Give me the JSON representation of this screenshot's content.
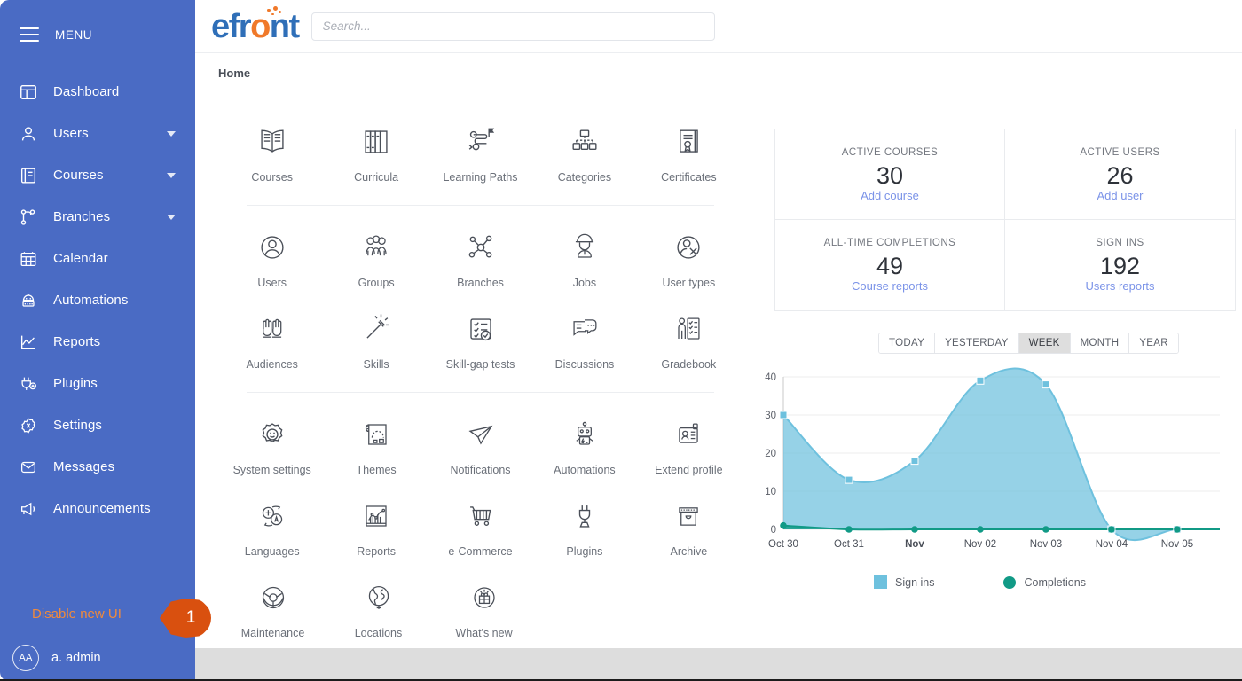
{
  "sidebar": {
    "menu_label": "MENU",
    "items": [
      {
        "label": "Dashboard",
        "icon": "dashboard-icon",
        "expandable": false
      },
      {
        "label": "Users",
        "icon": "user-icon",
        "expandable": true
      },
      {
        "label": "Courses",
        "icon": "book-icon",
        "expandable": true
      },
      {
        "label": "Branches",
        "icon": "branches-icon",
        "expandable": true
      },
      {
        "label": "Calendar",
        "icon": "calendar-icon",
        "expandable": false
      },
      {
        "label": "Automations",
        "icon": "robot-icon",
        "expandable": false
      },
      {
        "label": "Reports",
        "icon": "chart-line-icon",
        "expandable": false
      },
      {
        "label": "Plugins",
        "icon": "plug-icon",
        "expandable": false
      },
      {
        "label": "Settings",
        "icon": "gear-icon",
        "expandable": false
      },
      {
        "label": "Messages",
        "icon": "envelope-icon",
        "expandable": false
      },
      {
        "label": "Announcements",
        "icon": "megaphone-icon",
        "expandable": false
      }
    ],
    "disable_ui_label": "Disable new UI",
    "user": {
      "initials": "AA",
      "name": "a. admin"
    },
    "bg_color": "#4a6bc4",
    "accent_color": "#f08a3c"
  },
  "callout": {
    "number": "1",
    "color": "#d9500f"
  },
  "header": {
    "logo_text_1": "efr",
    "logo_text_o": "o",
    "logo_text_2": "nt",
    "logo_blue": "#2f6fb8",
    "logo_orange": "#f0792a"
  },
  "search": {
    "value": "",
    "placeholder": "Search..."
  },
  "breadcrumb": {
    "label": "Home"
  },
  "tiles": {
    "groups": [
      {
        "rows": [
          [
            {
              "label": "Courses",
              "icon": "open-book-icon"
            },
            {
              "label": "Curricula",
              "icon": "book-shelf-icon"
            },
            {
              "label": "Learning Paths",
              "icon": "learning-path-icon"
            },
            {
              "label": "Categories",
              "icon": "category-tree-icon"
            },
            {
              "label": "Certificates",
              "icon": "certificate-icon"
            }
          ]
        ]
      },
      {
        "rows": [
          [
            {
              "label": "Users",
              "icon": "user-circle-icon"
            },
            {
              "label": "Groups",
              "icon": "group-icon"
            },
            {
              "label": "Branches",
              "icon": "network-icon"
            },
            {
              "label": "Jobs",
              "icon": "hardhat-worker-icon"
            },
            {
              "label": "User types",
              "icon": "user-type-icon"
            }
          ],
          [
            {
              "label": "Audiences",
              "icon": "raised-hands-icon"
            },
            {
              "label": "Skills",
              "icon": "magic-wand-icon"
            },
            {
              "label": "Skill-gap tests",
              "icon": "checklist-icon"
            },
            {
              "label": "Discussions",
              "icon": "chat-bubbles-icon"
            },
            {
              "label": "Gradebook",
              "icon": "gradebook-icon"
            }
          ]
        ]
      },
      {
        "rows": [
          [
            {
              "label": "System settings",
              "icon": "gear-smile-icon"
            },
            {
              "label": "Themes",
              "icon": "blueprint-icon"
            },
            {
              "label": "Notifications",
              "icon": "paper-plane-icon"
            },
            {
              "label": "Automations",
              "icon": "robot-icon"
            },
            {
              "label": "Extend profile",
              "icon": "id-badge-icon"
            }
          ],
          [
            {
              "label": "Languages",
              "icon": "translate-icon"
            },
            {
              "label": "Reports",
              "icon": "chart-report-icon"
            },
            {
              "label": "e-Commerce",
              "icon": "shopping-cart-icon"
            },
            {
              "label": "Plugins",
              "icon": "plug-icon"
            },
            {
              "label": "Archive",
              "icon": "archive-box-icon"
            }
          ],
          [
            {
              "label": "Maintenance",
              "icon": "steering-wheel-icon"
            },
            {
              "label": "Locations",
              "icon": "globe-icon"
            },
            {
              "label": "What's new",
              "icon": "gift-burst-icon"
            }
          ]
        ]
      }
    ]
  },
  "stats": [
    {
      "label": "ACTIVE COURSES",
      "value": "30",
      "link": "Add course"
    },
    {
      "label": "ACTIVE USERS",
      "value": "26",
      "link": "Add user"
    },
    {
      "label": "ALL-TIME COMPLETIONS",
      "value": "49",
      "link": "Course reports"
    },
    {
      "label": "SIGN INS",
      "value": "192",
      "link": "Users reports"
    }
  ],
  "ranges": {
    "options": [
      "TODAY",
      "YESTERDAY",
      "WEEK",
      "MONTH",
      "YEAR"
    ],
    "active": "WEEK"
  },
  "chart_data": {
    "type": "area",
    "title": "",
    "xlabel": "",
    "ylabel": "",
    "ylim": [
      0,
      40
    ],
    "yticks": [
      0,
      10,
      20,
      30,
      40
    ],
    "grid": true,
    "legend_position": "bottom",
    "categories": [
      "Oct 30",
      "Oct 31",
      "Nov",
      "Nov 02",
      "Nov 03",
      "Nov 04",
      "Nov 05"
    ],
    "bold_category": "Nov",
    "series": [
      {
        "name": "Sign ins",
        "color": "#6ec1de",
        "marker": "square",
        "values": [
          30,
          13,
          18,
          39,
          38,
          0,
          0
        ]
      },
      {
        "name": "Completions",
        "color": "#119a86",
        "marker": "circle",
        "values": [
          1,
          0,
          0,
          0,
          0,
          0,
          0
        ]
      }
    ]
  }
}
